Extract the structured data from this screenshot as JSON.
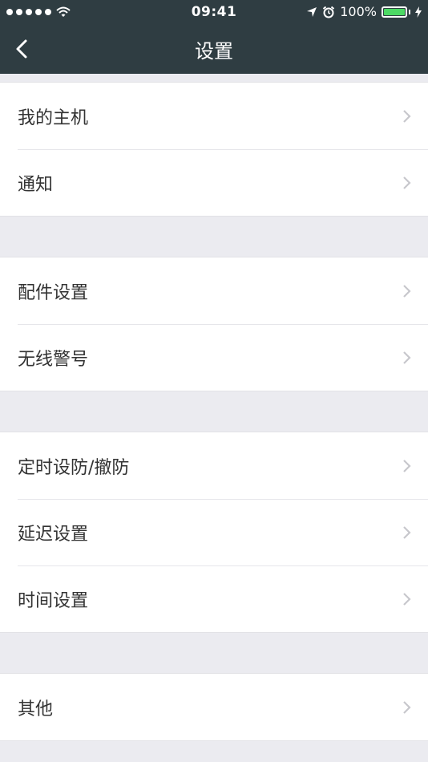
{
  "status_bar": {
    "time": "09:41",
    "battery_percent": "100%",
    "signal_bars": 5,
    "battery_color": "#4cd964"
  },
  "nav": {
    "title": "设置",
    "back_icon": "chevron-left-icon",
    "background": "#2f3d42"
  },
  "groups": [
    {
      "items": [
        {
          "label": "我的主机"
        },
        {
          "label": "通知"
        }
      ]
    },
    {
      "items": [
        {
          "label": "配件设置"
        },
        {
          "label": "无线警号"
        }
      ]
    },
    {
      "items": [
        {
          "label": "定时设防/撤防"
        },
        {
          "label": "延迟设置"
        },
        {
          "label": "时间设置"
        }
      ]
    },
    {
      "items": [
        {
          "label": "其他"
        }
      ]
    }
  ]
}
